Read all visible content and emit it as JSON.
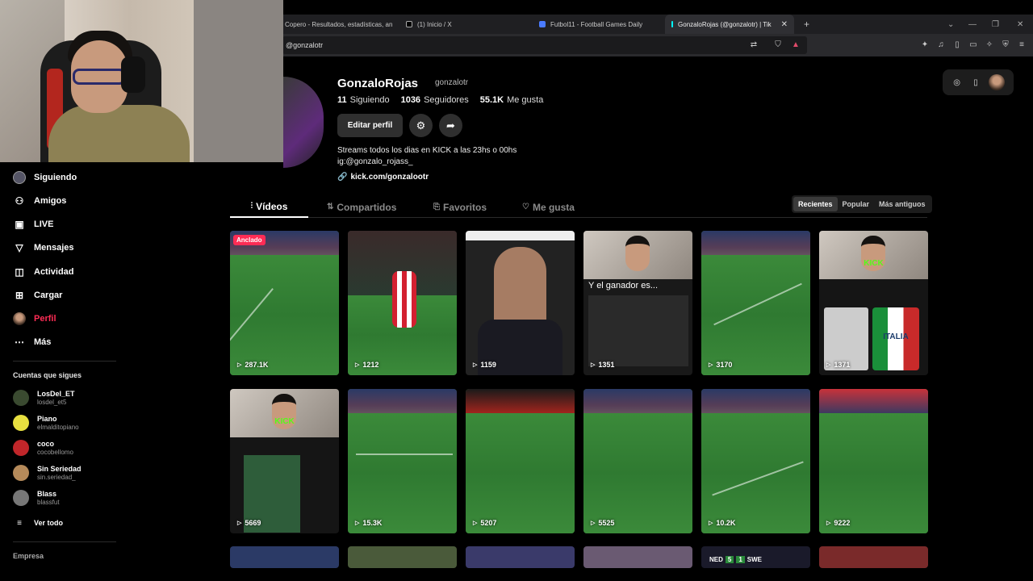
{
  "browser": {
    "tabs": [
      {
        "title": "Copero - Resultados, estadísticas, an",
        "active": false
      },
      {
        "title": "(1) Inicio / X",
        "active": false
      },
      {
        "title": "Futbol11 - Football Games Daily",
        "active": false
      },
      {
        "title": "GonzaloRojas (@gonzalotr) | Tik",
        "active": true
      }
    ],
    "new_tab": "+",
    "url": "@gonzalotr"
  },
  "profile": {
    "display_name": "GonzaloRojas",
    "username": "gonzalotr",
    "following_count": "11",
    "following_label": "Siguiendo",
    "followers_count": "1036",
    "followers_label": "Seguidores",
    "likes_count": "55.1K",
    "likes_label": "Me gusta",
    "edit_button": "Editar perfil",
    "bio_line1": "Streams todos los dias en KICK a las 23hs o 00hs",
    "bio_line2": "ig:@gonzalo_rojass_",
    "link": "kick.com/gonzalootr"
  },
  "sidebar": {
    "nav": [
      {
        "label": "Siguiendo",
        "icon": "following-avatar-icon"
      },
      {
        "label": "Amigos",
        "icon": "friends-icon"
      },
      {
        "label": "LIVE",
        "icon": "live-icon"
      },
      {
        "label": "Mensajes",
        "icon": "messages-icon"
      },
      {
        "label": "Actividad",
        "icon": "activity-icon"
      },
      {
        "label": "Cargar",
        "icon": "upload-icon"
      },
      {
        "label": "Perfil",
        "icon": "profile-icon",
        "active": true
      },
      {
        "label": "Más",
        "icon": "more-icon"
      }
    ],
    "following_header": "Cuentas que sigues",
    "following": [
      {
        "name": "LosDel_ET",
        "user": "losdel_et5"
      },
      {
        "name": "Piano",
        "user": "elmalditopiano"
      },
      {
        "name": "coco",
        "user": "cocobellomo"
      },
      {
        "name": "Sin Seriedad",
        "user": "sin.seriedad_"
      },
      {
        "name": "Blass",
        "user": "blassfut"
      }
    ],
    "see_all": "Ver todo",
    "footer": "Empresa"
  },
  "content_tabs": [
    {
      "label": "Vídeos",
      "active": true
    },
    {
      "label": "Compartidos"
    },
    {
      "label": "Favoritos"
    },
    {
      "label": "Me gusta"
    }
  ],
  "sort_options": [
    {
      "label": "Recientes",
      "active": true
    },
    {
      "label": "Popular"
    },
    {
      "label": "Más antiguos"
    }
  ],
  "videos": [
    {
      "views": "287.1K",
      "pinned_label": "Anclado"
    },
    {
      "views": "1212"
    },
    {
      "views": "1159"
    },
    {
      "views": "1351",
      "overlay": "Y el ganador es..."
    },
    {
      "views": "3170"
    },
    {
      "views": "1371",
      "overlay": "ITALIA"
    },
    {
      "views": "5669"
    },
    {
      "views": "15.3K"
    },
    {
      "views": "5207"
    },
    {
      "views": "5525"
    },
    {
      "views": "10.2K"
    },
    {
      "views": "9222"
    }
  ],
  "row3_badge": {
    "left": "NED",
    "score_left": "5",
    "score_right": "1",
    "right": "SWE"
  },
  "colors": {
    "accent": "#fe2c55",
    "kick": "#53fc18"
  }
}
